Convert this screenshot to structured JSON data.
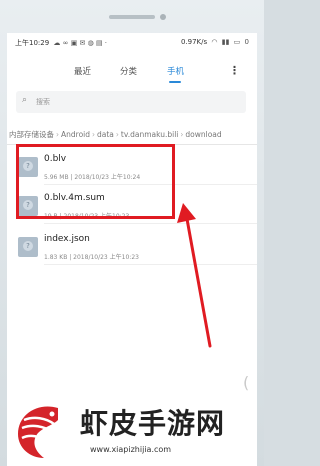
{
  "status_bar": {
    "time": "上午10:29",
    "network_speed": "0.97K/s",
    "battery": "0"
  },
  "tabs": [
    {
      "label": "最近",
      "active": false
    },
    {
      "label": "分类",
      "active": false
    },
    {
      "label": "手机",
      "active": true
    }
  ],
  "more_label": "⋮",
  "search": {
    "placeholder": "搜索"
  },
  "breadcrumb": [
    "内部存储设备",
    "Android",
    "data",
    "tv.danmaku.bili",
    "download"
  ],
  "files": [
    {
      "name": "0.blv",
      "size": "5.96 MB",
      "date": "2018/10/23 上午10:24"
    },
    {
      "name": "0.blv.4m.sum",
      "size": "19 B",
      "date": "2018/10/23 上午10:23"
    },
    {
      "name": "index.json",
      "size": "1.83 KB",
      "date": "2018/10/23 上午10:23"
    }
  ],
  "annotation": {
    "box_color": "#e01b22",
    "arrow_color": "#e01b22"
  },
  "accent_color": "#2a89d8",
  "watermark": {
    "title": "虾皮手游网",
    "url": "www.xiapizhijia.com"
  }
}
